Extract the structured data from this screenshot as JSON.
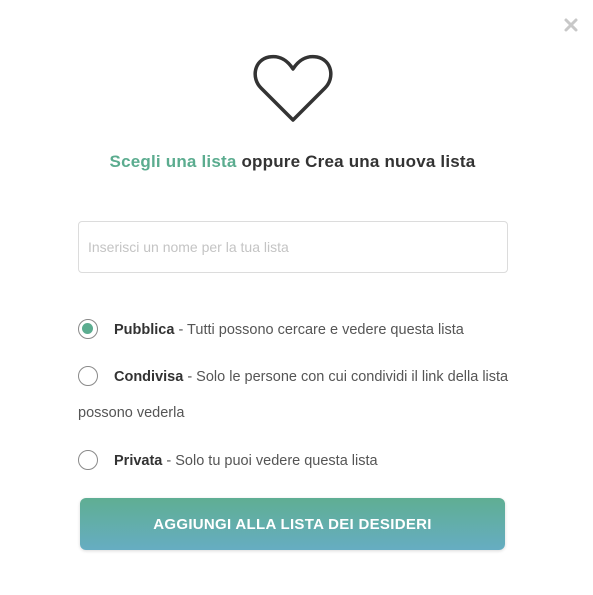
{
  "dialog": {
    "close_icon": "close-icon",
    "heart_icon": "heart-outline-icon",
    "title": {
      "choose_link": "Scegli una lista",
      "rest": " oppure Crea una nuova lista"
    },
    "input": {
      "value": "",
      "placeholder": "Inserisci un nome per la tua lista"
    },
    "options": [
      {
        "name": "Pubblica",
        "description": " - Tutti possono cercare e vedere questa lista",
        "checked": true
      },
      {
        "name": "Condivisa",
        "description": " - Solo le persone con cui condividi il link della lista possono vederla",
        "checked": false
      },
      {
        "name": "Privata",
        "description": " - Solo tu puoi vedere questa lista",
        "checked": false
      }
    ],
    "submit_label": "AGGIUNGI ALLA LISTA DEI DESIDERI"
  },
  "colors": {
    "accent": "#5bac8f",
    "button_gradient_start": "#5fae93",
    "button_gradient_end": "#66adc2"
  }
}
